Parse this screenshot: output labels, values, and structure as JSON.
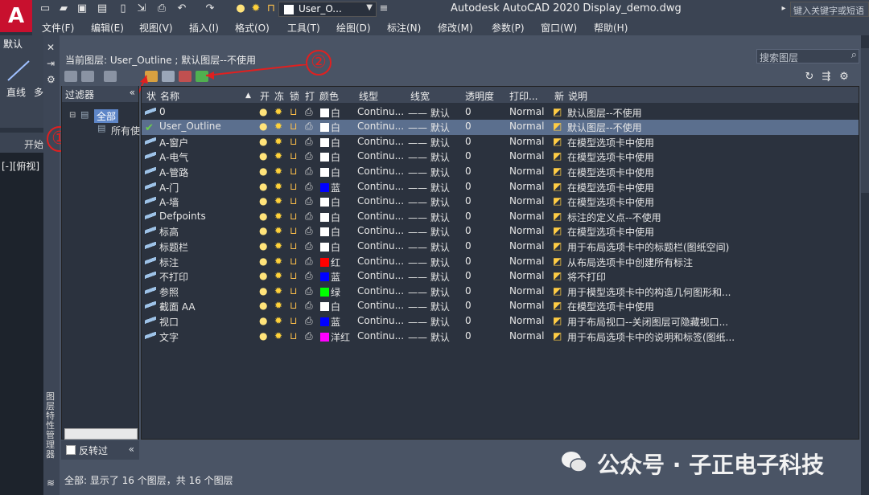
{
  "app": {
    "logo": "A",
    "title": "Autodesk AutoCAD 2020    Display_demo.dwg",
    "search_placeholder": "键入关键字或短语",
    "current_layer_combo": "User_O..."
  },
  "menu": [
    "文件(F)",
    "编辑(E)",
    "视图(V)",
    "插入(I)",
    "格式(O)",
    "工具(T)",
    "绘图(D)",
    "标注(N)",
    "修改(M)",
    "参数(P)",
    "窗口(W)",
    "帮助(H)"
  ],
  "ribbon": {
    "tab": "默认",
    "line_tool": "直线",
    "more": "多",
    "start_tab": "开始",
    "viewport_label": "[-][俯视]"
  },
  "palette": {
    "current_layer": "当前图层: User_Outline ; 默认图层--不使用",
    "search_placeholder": "搜索图层",
    "side_title": "图层特性管理器",
    "filter_header": "过滤器",
    "tree": {
      "all": "全部",
      "used": "所有使"
    },
    "invert_label": "反转过",
    "status": "全部: 显示了 16 个图层，共 16 个图层",
    "annotations": [
      "①",
      "②"
    ]
  },
  "columns": [
    "状",
    "名称",
    "开",
    "冻",
    "锁",
    "打",
    "颜色",
    "线型",
    "线宽",
    "透明度",
    "打印...",
    "新",
    "说明"
  ],
  "layers": [
    {
      "name": "0",
      "color": "白",
      "swatch": "#ffffff",
      "linetype": "Continu...",
      "lineweight": "—— 默认",
      "transparency": "0",
      "plot_style": "Normal",
      "desc": "默认图层--不使用",
      "current": false,
      "selected": false
    },
    {
      "name": "User_Outline",
      "color": "白",
      "swatch": "#ffffff",
      "linetype": "Continu...",
      "lineweight": "—— 默认",
      "transparency": "0",
      "plot_style": "Normal",
      "desc": "默认图层--不使用",
      "current": true,
      "selected": true
    },
    {
      "name": "A-窗户",
      "color": "白",
      "swatch": "#ffffff",
      "linetype": "Continu...",
      "lineweight": "—— 默认",
      "transparency": "0",
      "plot_style": "Normal",
      "desc": "在模型选项卡中使用",
      "current": false,
      "selected": false
    },
    {
      "name": "A-电气",
      "color": "白",
      "swatch": "#ffffff",
      "linetype": "Continu...",
      "lineweight": "—— 默认",
      "transparency": "0",
      "plot_style": "Normal",
      "desc": "在模型选项卡中使用",
      "current": false,
      "selected": false
    },
    {
      "name": "A-管路",
      "color": "白",
      "swatch": "#ffffff",
      "linetype": "Continu...",
      "lineweight": "—— 默认",
      "transparency": "0",
      "plot_style": "Normal",
      "desc": "在模型选项卡中使用",
      "current": false,
      "selected": false
    },
    {
      "name": "A-门",
      "color": "蓝",
      "swatch": "#0000ff",
      "linetype": "Continu...",
      "lineweight": "—— 默认",
      "transparency": "0",
      "plot_style": "Normal",
      "desc": "在模型选项卡中使用",
      "current": false,
      "selected": false
    },
    {
      "name": "A-墙",
      "color": "白",
      "swatch": "#ffffff",
      "linetype": "Continu...",
      "lineweight": "—— 默认",
      "transparency": "0",
      "plot_style": "Normal",
      "desc": "在模型选项卡中使用",
      "current": false,
      "selected": false
    },
    {
      "name": "Defpoints",
      "color": "白",
      "swatch": "#ffffff",
      "linetype": "Continu...",
      "lineweight": "—— 默认",
      "transparency": "0",
      "plot_style": "Normal",
      "desc": "标注的定义点--不使用",
      "current": false,
      "selected": false
    },
    {
      "name": "标高",
      "color": "白",
      "swatch": "#ffffff",
      "linetype": "Continu...",
      "lineweight": "—— 默认",
      "transparency": "0",
      "plot_style": "Normal",
      "desc": "在模型选项卡中使用",
      "current": false,
      "selected": false
    },
    {
      "name": "标题栏",
      "color": "白",
      "swatch": "#ffffff",
      "linetype": "Continu...",
      "lineweight": "—— 默认",
      "transparency": "0",
      "plot_style": "Normal",
      "desc": "用于布局选项卡中的标题栏(图纸空间)",
      "current": false,
      "selected": false
    },
    {
      "name": "标注",
      "color": "红",
      "swatch": "#ff0000",
      "linetype": "Continu...",
      "lineweight": "—— 默认",
      "transparency": "0",
      "plot_style": "Normal",
      "desc": "从布局选项卡中创建所有标注",
      "current": false,
      "selected": false
    },
    {
      "name": "不打印",
      "color": "蓝",
      "swatch": "#0000ff",
      "linetype": "Continu...",
      "lineweight": "—— 默认",
      "transparency": "0",
      "plot_style": "Normal",
      "desc": "将不打印",
      "current": false,
      "selected": false
    },
    {
      "name": "参照",
      "color": "绿",
      "swatch": "#00ff00",
      "linetype": "Continu...",
      "lineweight": "—— 默认",
      "transparency": "0",
      "plot_style": "Normal",
      "desc": "用于模型选项卡中的构造几何图形和...",
      "current": false,
      "selected": false
    },
    {
      "name": "截面 AA",
      "color": "白",
      "swatch": "#ffffff",
      "linetype": "Continu...",
      "lineweight": "—— 默认",
      "transparency": "0",
      "plot_style": "Normal",
      "desc": "在模型选项卡中使用",
      "current": false,
      "selected": false
    },
    {
      "name": "视口",
      "color": "蓝",
      "swatch": "#0000ff",
      "linetype": "Continu...",
      "lineweight": "—— 默认",
      "transparency": "0",
      "plot_style": "Normal",
      "desc": "用于布局视口--关闭图层可隐藏视口...",
      "current": false,
      "selected": false
    },
    {
      "name": "文字",
      "color": "洋红",
      "swatch": "#ff00ff",
      "linetype": "Continu...",
      "lineweight": "—— 默认",
      "transparency": "0",
      "plot_style": "Normal",
      "desc": "用于布局选项卡中的说明和标签(图纸...",
      "current": false,
      "selected": false
    }
  ],
  "watermark": "公众号 · 子正电子科技"
}
